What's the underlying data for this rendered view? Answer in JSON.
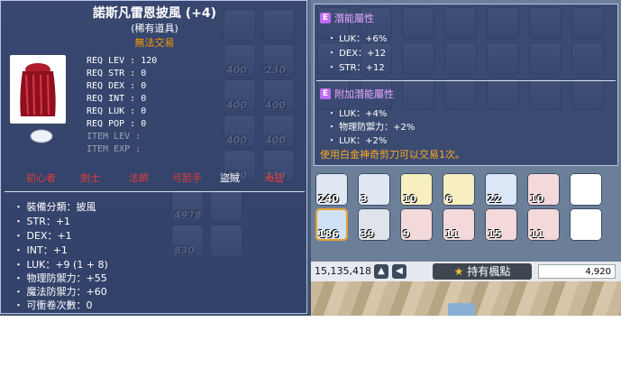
{
  "item": {
    "name": "諾斯凡雷恩披風 (+4)",
    "type": "(稀有道具)",
    "trade": "無法交易",
    "req": [
      {
        "label": "REQ LEV",
        "value": "120",
        "gray": false
      },
      {
        "label": "REQ STR",
        "value": "0",
        "gray": false
      },
      {
        "label": "REQ DEX",
        "value": "0",
        "gray": false
      },
      {
        "label": "REQ INT",
        "value": "0",
        "gray": false
      },
      {
        "label": "REQ LUK",
        "value": "0",
        "gray": false
      },
      {
        "label": "REQ POP",
        "value": "0",
        "gray": false
      },
      {
        "label": "ITEM LEV",
        "value": "",
        "gray": true
      },
      {
        "label": "ITEM EXP",
        "value": "",
        "gray": true
      }
    ],
    "jobs": [
      {
        "label": "初心者",
        "active": false
      },
      {
        "label": "劍士",
        "active": false
      },
      {
        "label": "法師",
        "active": false
      },
      {
        "label": "弓箭手",
        "active": false
      },
      {
        "label": "盜賊",
        "active": true
      },
      {
        "label": "海盜",
        "active": false
      }
    ],
    "stats": [
      "・ 裝備分類：披風",
      "・ STR：+1",
      "・ DEX：+1",
      "・ INT：+1",
      "・ LUK：+9 (1 + 8)",
      "・ 物理防禦力：+55",
      "・ 魔法防禦力：+60",
      "・ 可衝卷次數：0"
    ],
    "colors": {
      "name": "#ffffff",
      "trade": "#ff9900",
      "job_inactive": "#e53b3b",
      "job_active": "#ffffff"
    }
  },
  "potential": {
    "badge": "E",
    "title": "潛能屬性",
    "lines": [
      "・ LUK：+6%",
      "・ DEX：+12",
      "・ STR：+12"
    ],
    "additional_title": "附加潛能屬性",
    "additional_lines": [
      "・ LUK：+4%",
      "・ 物理防禦力：+2%",
      "・ LUK：+2%"
    ],
    "note": "使用白金神奇剪刀可以交易1次。"
  },
  "inventory": {
    "left_counts": [
      "400",
      "230",
      "400",
      "400",
      "400",
      "400",
      "400",
      "230",
      "4978",
      "830"
    ],
    "right_row1": [
      "240",
      "3",
      "10",
      "6",
      "22",
      "10",
      ""
    ],
    "right_row2": [
      "186",
      "39",
      "9",
      "11",
      "15",
      "11",
      ""
    ]
  },
  "bottom": {
    "meso": "15,135,418",
    "points_label": "持有楓點",
    "points_value": "4,920",
    "left_btn": "◀",
    "up_btn": "▲",
    "star_icon": "star-icon"
  }
}
